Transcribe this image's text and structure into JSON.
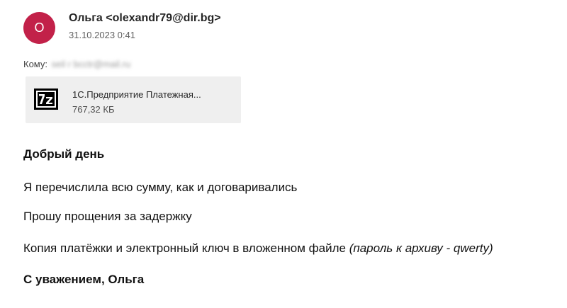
{
  "sender": {
    "avatar_letter": "О",
    "name": "Ольга",
    "email": "<olexandr79@dir.bg>",
    "date": "31.10.2023 0:41"
  },
  "recipients": {
    "label": "Кому:",
    "value": "seil r bcctr@mail.ru"
  },
  "attachment": {
    "icon": "7z-archive-icon",
    "name": "1С.Предприятие Платежная...",
    "size": "767,32 КБ"
  },
  "message": {
    "greeting": "Добрый день",
    "line1": "Я перечислила всю сумму, как и договаривались",
    "line2": "Прошу прощения за задержку",
    "line3_text": "Копия платёжки и электронный ключ в вложенном файле",
    "line3_note": "(пароль к архиву - qwerty)",
    "signoff": "С уважением, Ольга"
  },
  "colors": {
    "avatar_bg": "#c22149",
    "attachment_bg": "#efefef"
  }
}
